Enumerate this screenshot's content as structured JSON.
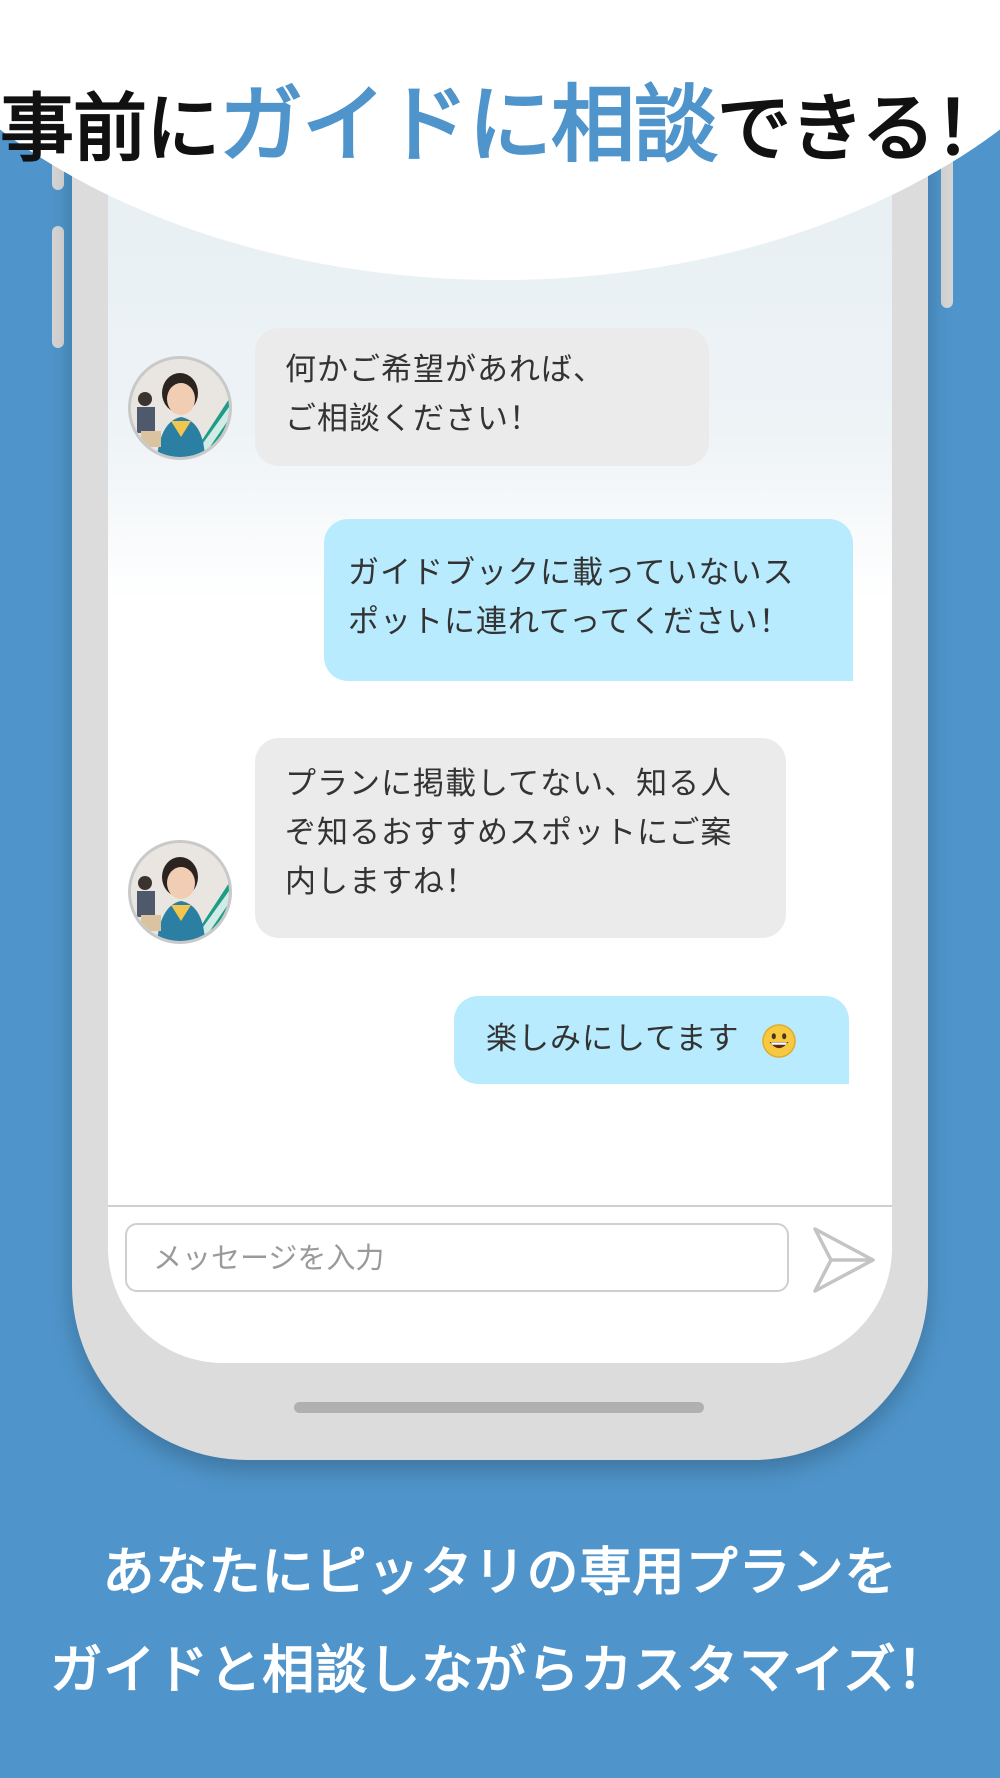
{
  "header": {
    "before": "事前に",
    "highlight": "ガイドに相談",
    "after": "できる！"
  },
  "chat": {
    "messages": [
      {
        "sender": "guide",
        "lines": [
          "何かご希望があれば、",
          "ご相談ください！"
        ]
      },
      {
        "sender": "user",
        "lines": [
          "ガイドブックに載っていないス",
          "ポットに連れてってください！"
        ]
      },
      {
        "sender": "guide",
        "lines": [
          "プランに掲載してない、知る人",
          "ぞ知るおすすめスポットにご案",
          "内しますね！"
        ]
      },
      {
        "sender": "user",
        "lines": [
          "楽しみにしてます"
        ],
        "emoji": "grinning-face-emoji"
      }
    ],
    "input_placeholder": "メッセージを入力",
    "send_icon": "send-icon"
  },
  "footer": {
    "line1": "あなたにピッタリの専用プランを",
    "line2": "ガイドと相談しながらカスタマイズ！"
  },
  "colors": {
    "background": "#4f95cb",
    "accent_text": "#4f95cb",
    "guide_bubble": "#ebebeb",
    "user_bubble": "#b8ebfd"
  }
}
